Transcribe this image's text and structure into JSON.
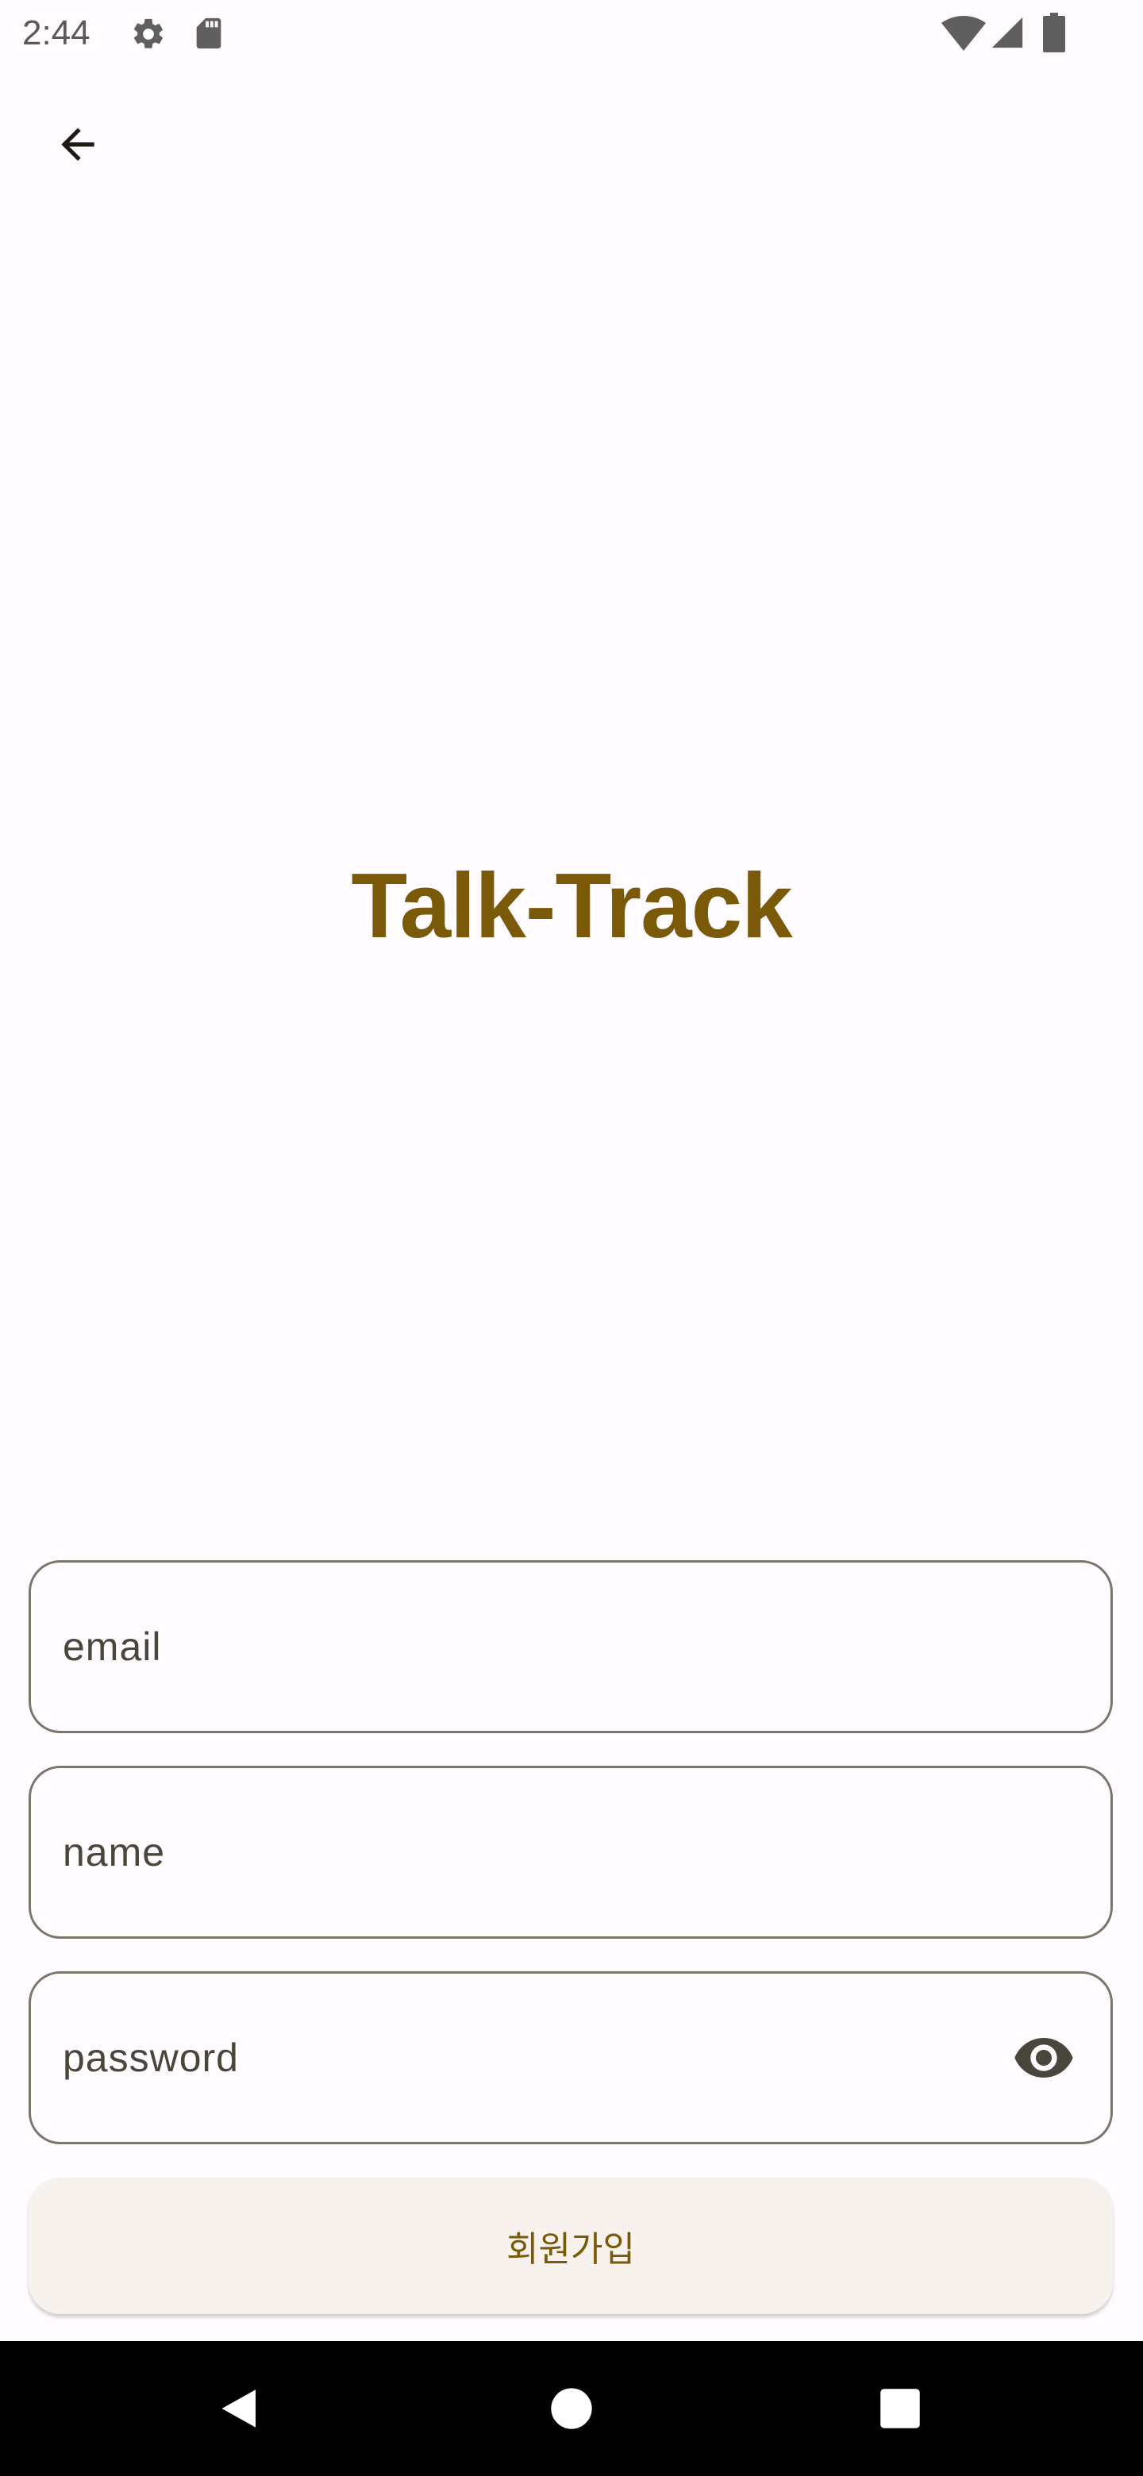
{
  "status_bar": {
    "time": "2:44",
    "icons": [
      "gear-icon",
      "sd-card-icon",
      "wifi-icon",
      "signal-icon",
      "battery-icon"
    ]
  },
  "app_bar": {
    "back_icon": "arrow-back-icon"
  },
  "title": "Talk-Track",
  "form": {
    "email_placeholder": "email",
    "name_placeholder": "name",
    "password_placeholder": "password",
    "password_toggle_icon": "eye-icon",
    "submit_label": "회원가입"
  },
  "nav_bar": {
    "icons": [
      "back-triangle-icon",
      "home-circle-icon",
      "recents-square-icon"
    ]
  },
  "colors": {
    "brand": "#7a5908",
    "background": "#fffbfe",
    "outline": "#7c766a",
    "button_surface": "#f7f2ee"
  }
}
